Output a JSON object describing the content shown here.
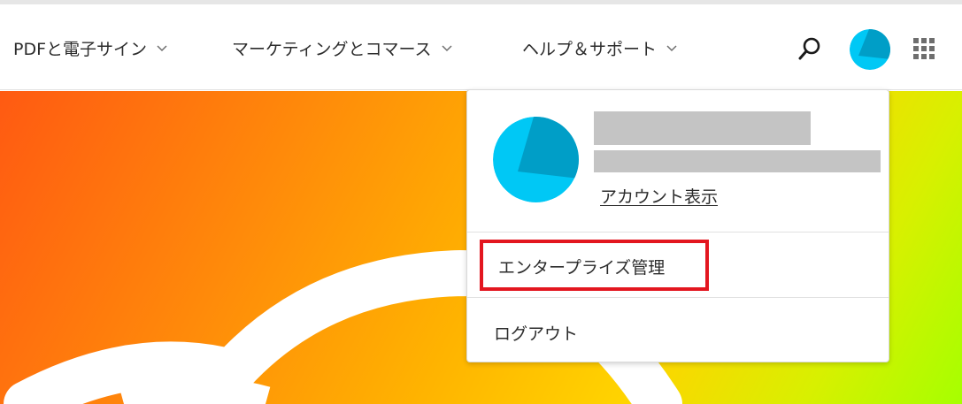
{
  "nav": {
    "items": [
      {
        "label": "PDFと電子サイン"
      },
      {
        "label": "マーケティングとコマース"
      },
      {
        "label": "ヘルプ＆サポート"
      }
    ],
    "icons": {
      "search": "search-icon",
      "apps": "apps-grid-icon",
      "chevron": "chevron-down-icon"
    }
  },
  "account_menu": {
    "view_account_label": "アカウント表示",
    "enterprise_label": "エンタープライズ管理",
    "logout_label": "ログアウト"
  },
  "colors": {
    "avatar_light": "#00c8f5",
    "avatar_dark": "#009ec7",
    "highlight": "#e3161f",
    "redacted": "#c4c4c4"
  }
}
